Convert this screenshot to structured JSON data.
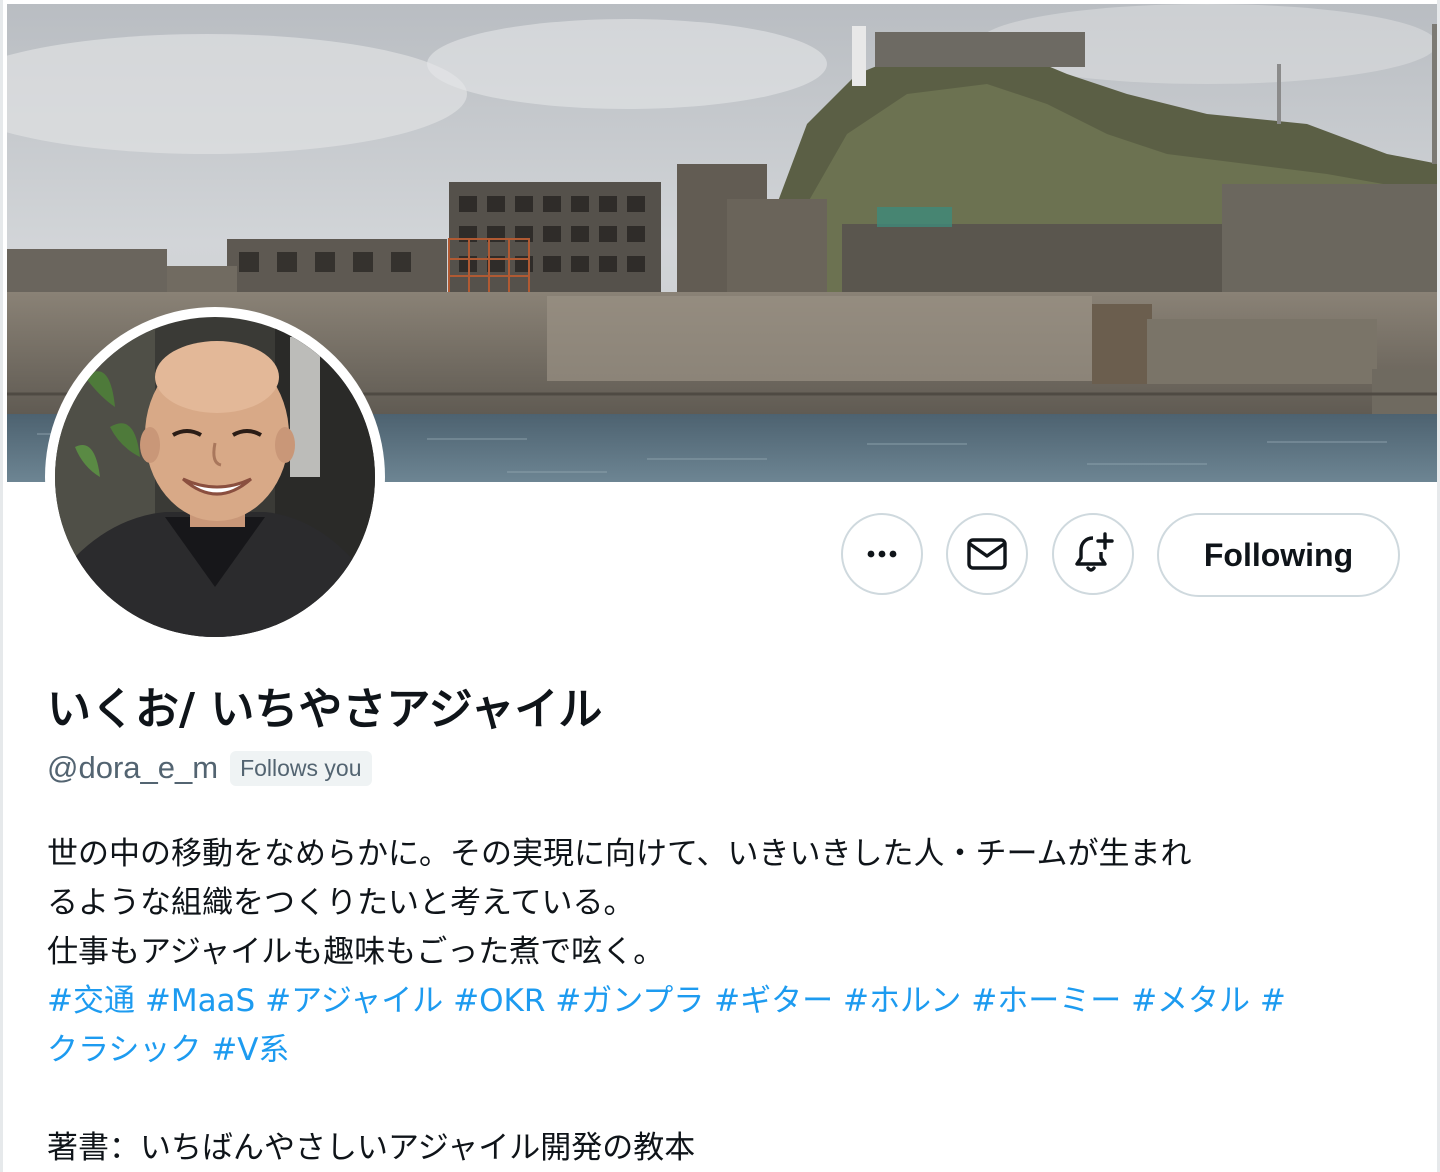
{
  "profile": {
    "display_name": "いくお/ いちやさアジャイル",
    "handle": "@dora_e_m",
    "follows_you_label": "Follows you",
    "following_label": "Following",
    "bio_lines": [
      "世の中の移動をなめらかに。その実現に向けて、いきいきした人・チームが生まれ",
      "るような組織をつくりたいと考えている。",
      "仕事もアジャイルも趣味もごった煮で呟く。"
    ],
    "hashtags_line1": [
      "#交通",
      "#MaaS",
      "#アジャイル",
      "#OKR",
      "#ガンプラ",
      "#ギター",
      "#ホルン",
      "#ホーミー",
      "#メタル",
      "#"
    ],
    "hashtags_line2": [
      "クラシック",
      "#V系"
    ],
    "book_line": "著書：いちばんやさしいアジャイル開発の教本"
  },
  "icons": {
    "more": "more-horizontal-icon",
    "message": "envelope-icon",
    "notify": "bell-plus-icon"
  },
  "colors": {
    "link": "#1d9bf0",
    "text": "#0f1419",
    "secondary": "#536471",
    "border": "#cfd9de"
  }
}
